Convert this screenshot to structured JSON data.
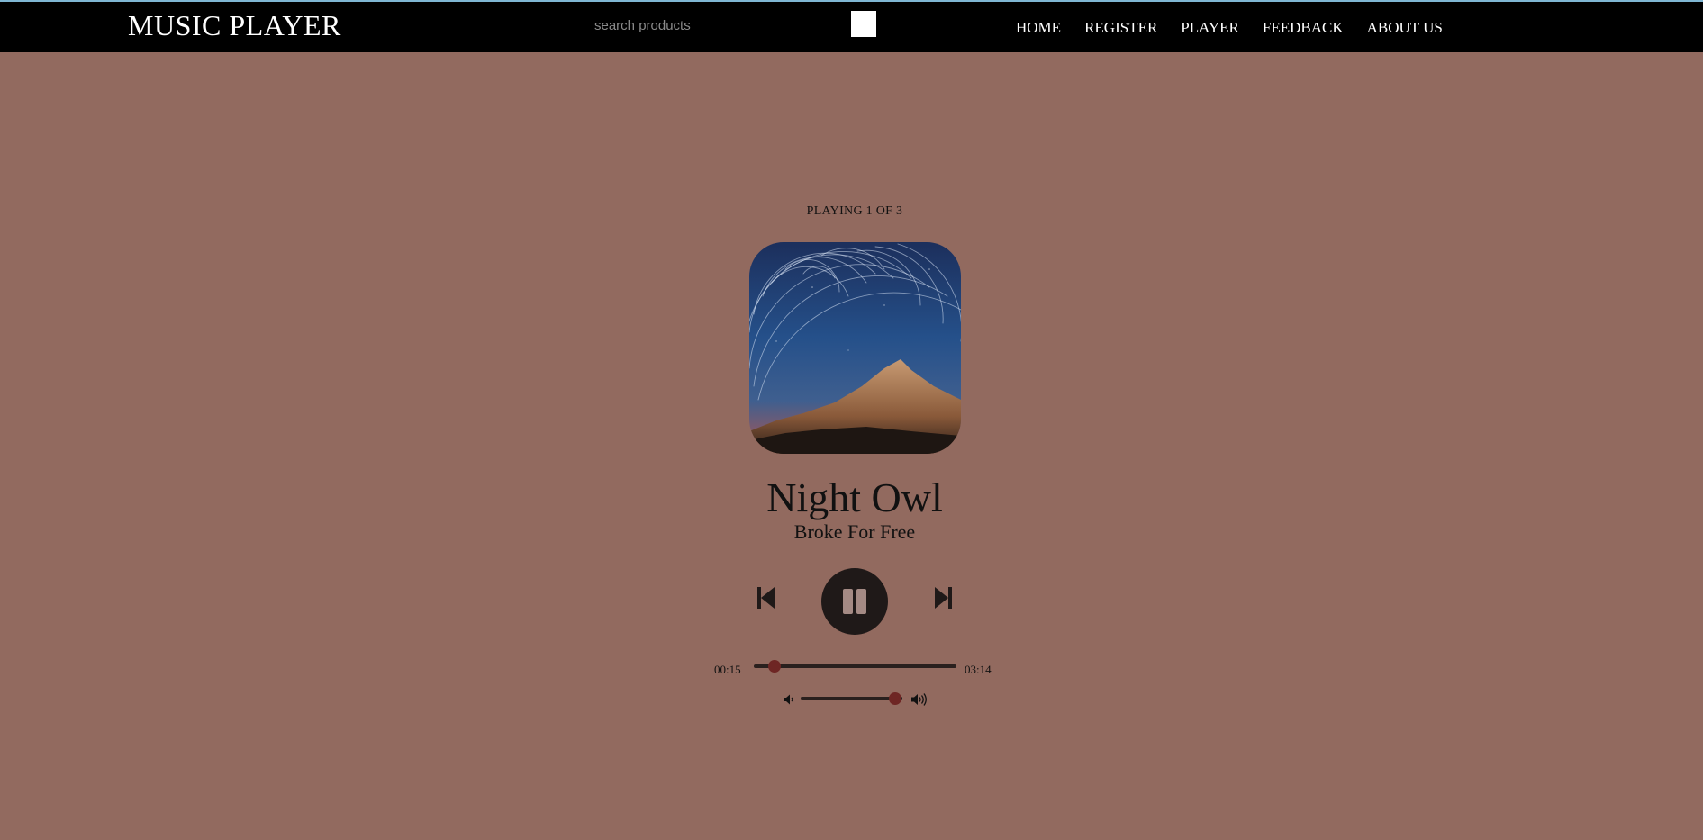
{
  "header": {
    "brand": "MUSIC PLAYER",
    "search": {
      "placeholder": "search products",
      "value": ""
    },
    "nav": [
      "HOME",
      "REGISTER",
      "PLAYER",
      "FEEDBACK",
      "ABOUT US"
    ]
  },
  "player": {
    "status": "PLAYING 1 OF 3",
    "track_index": 1,
    "track_count": 3,
    "title": "Night Owl",
    "artist": "Broke For Free",
    "state": "playing",
    "current_time": "00:15",
    "total_time": "03:14",
    "progress": 0.1,
    "volume": 0.93
  },
  "colors": {
    "background": "#926a5f",
    "header": "#000000",
    "accent": "#6e2624",
    "control": "#1f1918"
  },
  "icons": {
    "prev": "skip-previous-icon",
    "play_pause": "pause-icon",
    "next": "skip-next-icon",
    "volume_low": "volume-low-icon",
    "volume_high": "volume-high-icon"
  }
}
